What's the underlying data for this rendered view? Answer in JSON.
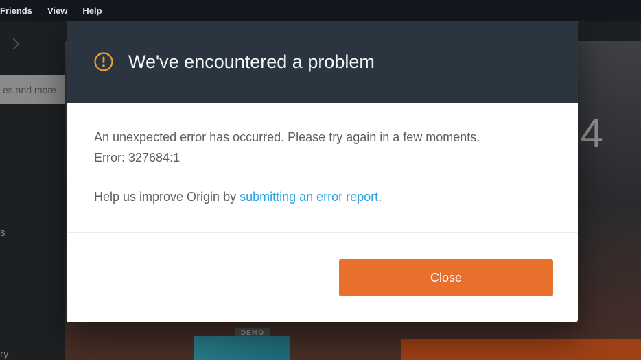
{
  "menubar": {
    "items": [
      "Friends",
      "View",
      "Help"
    ]
  },
  "sidebar": {
    "search_placeholder": "es and more",
    "text_1": "s",
    "text_2": "ry"
  },
  "background": {
    "game_number": "4",
    "demo_label": "DEMO"
  },
  "modal": {
    "title": "We've encountered a problem",
    "body_line_1": "An unexpected error has occurred. Please try again in a few moments.",
    "body_line_2": "Error: 327684:1",
    "help_prefix": "Help us improve Origin by ",
    "help_link": "submitting an error report",
    "help_suffix": ".",
    "close_label": "Close"
  }
}
